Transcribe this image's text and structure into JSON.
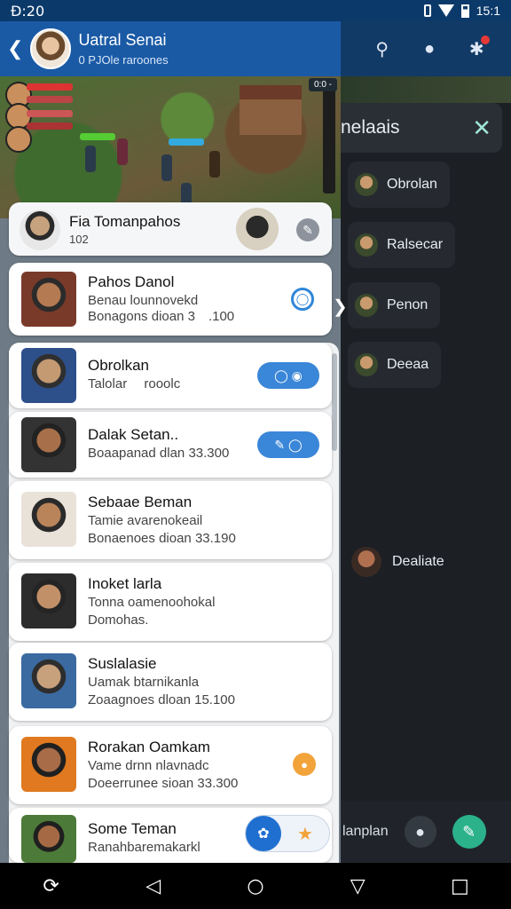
{
  "status_bar": {
    "time": "Đ:20",
    "battery_text": "15:1"
  },
  "header": {
    "title": "Uatral Senai",
    "subtitle": "0 PJOle raroones"
  },
  "game_overlay": {
    "tag": "0:0 -"
  },
  "top_card": {
    "name": "Fia Tomanpahos",
    "line": "102"
  },
  "contacts": [
    {
      "name": "Pahos Danol",
      "line1": "Benau lounnovekd",
      "line2": "Bonagons dioan 3 .100"
    },
    {
      "name": "Obrolkan",
      "line1": "Talolar  rooolc"
    },
    {
      "name": "Dalak Setan..",
      "line1": "Boaapanad dlan 33.300"
    },
    {
      "name": "Sebaae Beman",
      "line1": "Tamie avarenokeail",
      "line2": "Bonaenoes dioan 33.190"
    },
    {
      "name": "Inoket larla",
      "line1": "Tonna oamenoohokal",
      "line2": "Domohas."
    },
    {
      "name": "Suslalasie",
      "line1": "Uamak btarnikanla",
      "line2": "Zoaagnoes dloan 15.100"
    },
    {
      "name": "Rorakan Oamkam",
      "line1": "Vame drnn nlavnadc",
      "line2": "Doeerrunee sioan 33.300"
    },
    {
      "name": "Some Teman",
      "line1": "Ranahbaremakarkl"
    }
  ],
  "drawer": {
    "title": "nelaais",
    "items": [
      "Obrolan",
      "Ralsecar",
      "Penon",
      "Deeaa"
    ],
    "solo_item": "Dealiate",
    "bottom_label": "lanplan"
  },
  "colors": {
    "header_blue": "#1a5aa5",
    "accent_blue": "#2f86d9",
    "accent_orange": "#f2a33a",
    "drawer_bg": "#1c1f24"
  }
}
